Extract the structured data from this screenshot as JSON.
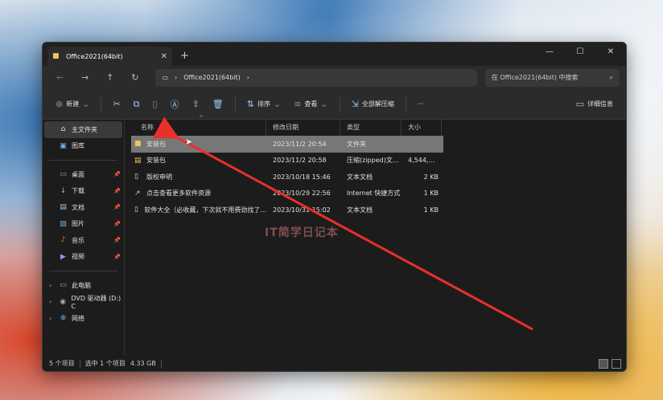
{
  "window": {
    "tab_title": "Office2021(64bit)",
    "close_tab": "✕",
    "new_tab": "+",
    "controls": [
      "—",
      "☐",
      "✕"
    ]
  },
  "nav": {
    "back": "←",
    "forward": "→",
    "up": "↑",
    "refresh": "↻",
    "breadcrumb": "Office2021(64bit)",
    "search_placeholder": "在 Office2021(64bit) 中搜索"
  },
  "toolbar": {
    "new_label": "新建",
    "sort_label": "排序",
    "view_label": "查看",
    "extract_label": "全部解压缩",
    "more_label": "···",
    "details_label": "详细信息"
  },
  "sidebar": {
    "quick": [
      {
        "label": "主文件夹",
        "icon": "⌂",
        "active": true
      },
      {
        "label": "图库",
        "icon": "▣",
        "active": false
      }
    ],
    "pinned": [
      {
        "label": "桌面",
        "icon": "▭"
      },
      {
        "label": "下载",
        "icon": "↓"
      },
      {
        "label": "文档",
        "icon": "▤"
      },
      {
        "label": "图片",
        "icon": "▨"
      },
      {
        "label": "音乐",
        "icon": "♪"
      },
      {
        "label": "视频",
        "icon": "▶"
      }
    ],
    "devices": [
      {
        "label": "此电脑",
        "icon": "▭"
      },
      {
        "label": "DVD 驱动器 (D:) C",
        "icon": "◉"
      },
      {
        "label": "网络",
        "icon": "⊕"
      }
    ]
  },
  "columns": {
    "name": "名称",
    "date": "修改日期",
    "type": "类型",
    "size": "大小"
  },
  "files": [
    {
      "name": "安装包",
      "date": "2023/11/2 20:54",
      "type": "文件夹",
      "size": "",
      "icon": "folder"
    },
    {
      "name": "安装包",
      "date": "2023/11/2 20:58",
      "type": "压缩(zipped)文件...",
      "size": "4,544,738...",
      "icon": "zip-folder"
    },
    {
      "name": "版权申明",
      "date": "2023/10/18 15:46",
      "type": "文本文档",
      "size": "2 KB",
      "icon": "doc"
    },
    {
      "name": "点击查看更多软件资源",
      "date": "2023/10/29 22:56",
      "type": "Internet 快捷方式",
      "size": "1 KB",
      "icon": "shortcut"
    },
    {
      "name": "软件大全（必收藏，下次就不用费劲找了...",
      "date": "2023/10/31 15:02",
      "type": "文本文档",
      "size": "1 KB",
      "icon": "doc"
    }
  ],
  "watermark": "IT简学日记本",
  "status": {
    "count": "5 个项目",
    "selected": "选中 1 个项目",
    "size": "4.33 GB"
  },
  "colors": {
    "arrow": "#e8302a",
    "folder": "#f2c55c",
    "accent": "#9cc7f0"
  }
}
